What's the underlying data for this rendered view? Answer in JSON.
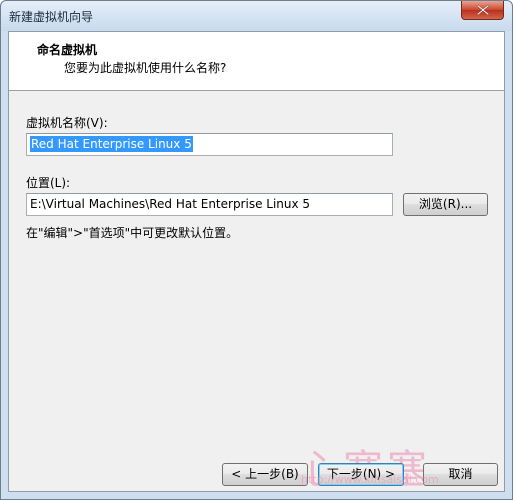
{
  "window": {
    "title": "新建虚拟机向导"
  },
  "header": {
    "title": "命名虚拟机",
    "subtitle": "您要为此虚拟机使用什么名称?"
  },
  "form": {
    "name_label": "虚拟机名称(V):",
    "name_value": "Red Hat Enterprise Linux 5",
    "location_label": "位置(L):",
    "location_value": "E:\\Virtual Machines\\Red Hat Enterprise Linux 5",
    "browse_label": "浏览(R)...",
    "hint": "在\"编辑\">\"首选项\"中可更改默认位置。"
  },
  "buttons": {
    "back_label": "< 上一步(B)",
    "next_label": "下一步(N) >",
    "cancel_label": "取消"
  },
  "watermark": {
    "text": "心塞塞",
    "url": "http://www.xinsaisai.com"
  },
  "colors": {
    "selection": "#3399ff",
    "title_bar": "#c8daee",
    "close_button": "#c9452d"
  }
}
